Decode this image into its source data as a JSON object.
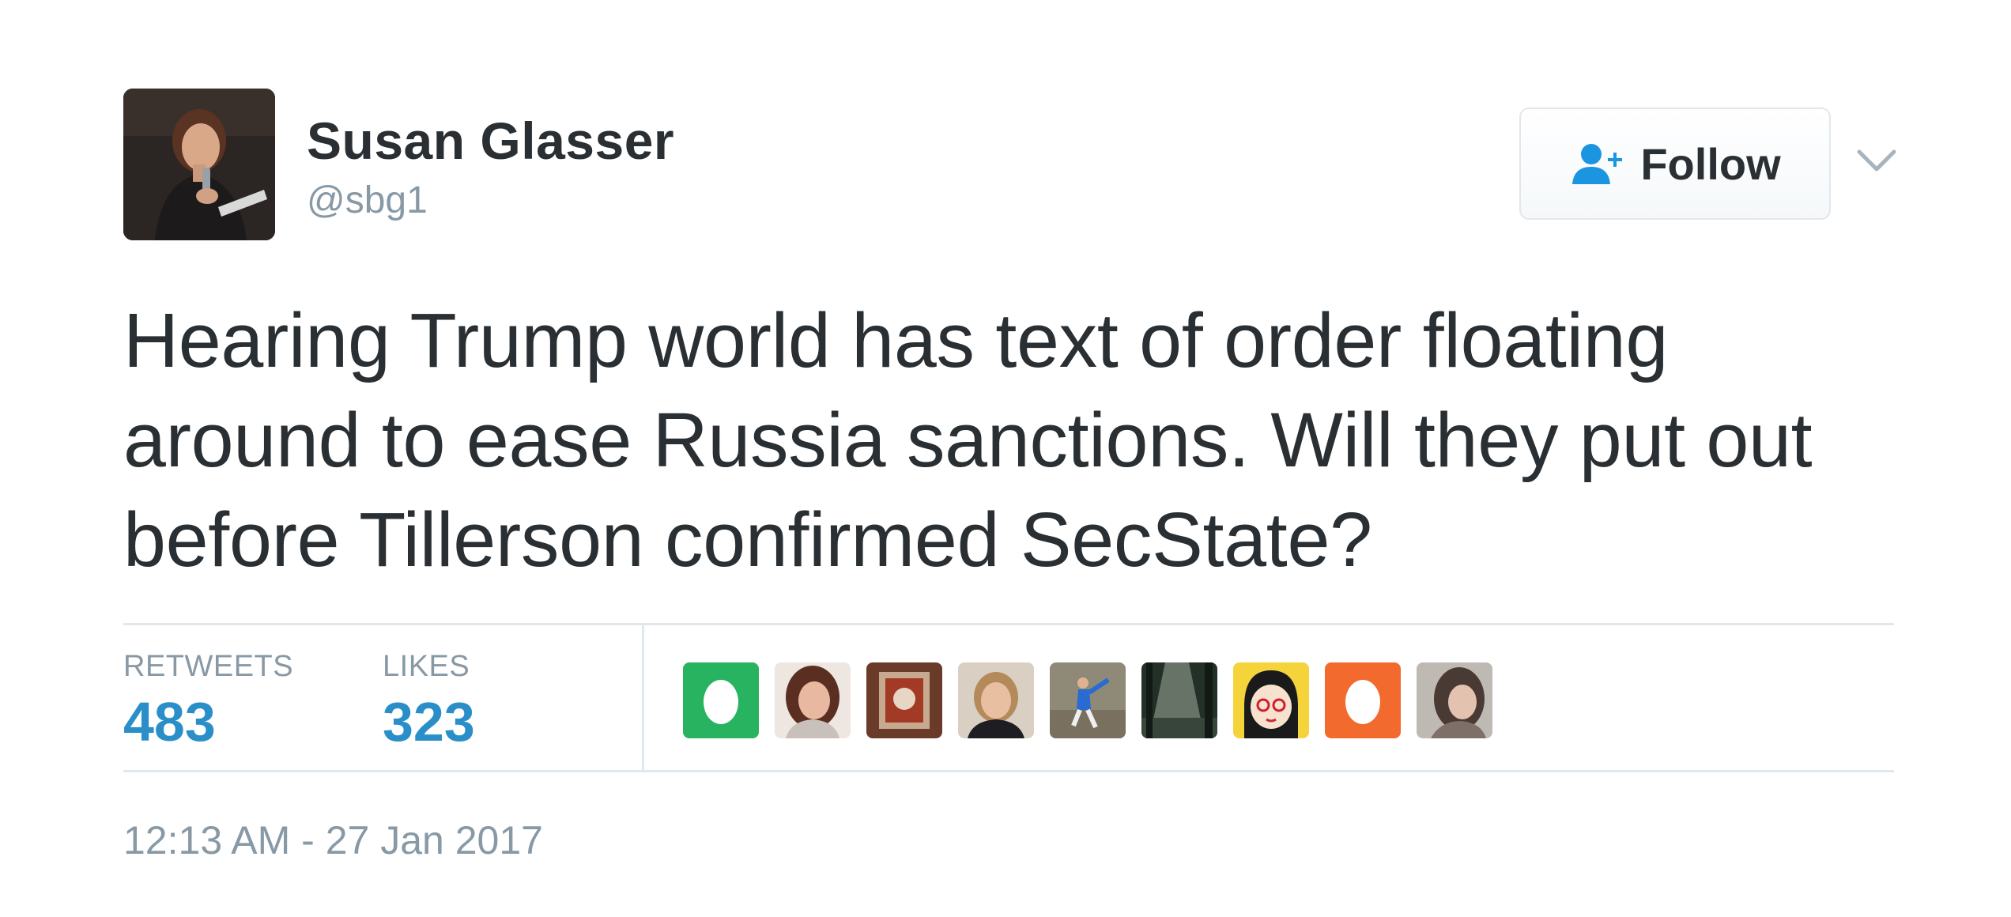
{
  "user": {
    "name": "Susan Glasser",
    "handle": "@sbg1"
  },
  "follow_button": {
    "label": "Follow",
    "icon": "follow-user-icon"
  },
  "menu_icon": "chevron-down-icon",
  "tweet": {
    "text": "Hearing Trump world has text of order floating around to ease Russia sanctions. Will they put out before Tillerson confirmed SecState?"
  },
  "stats": {
    "retweets_label": "RETWEETS",
    "retweets_value": "483",
    "likes_label": "LIKES",
    "likes_value": "323"
  },
  "likers_count_shown": 9,
  "timestamp": "12:13 AM - 27 Jan 2017",
  "colors": {
    "accent": "#1b95e0",
    "muted": "#8899a6",
    "text": "#292f33",
    "divider": "#e1e8ed",
    "egg_green": "#27b35f",
    "egg_orange": "#f26a2e"
  }
}
